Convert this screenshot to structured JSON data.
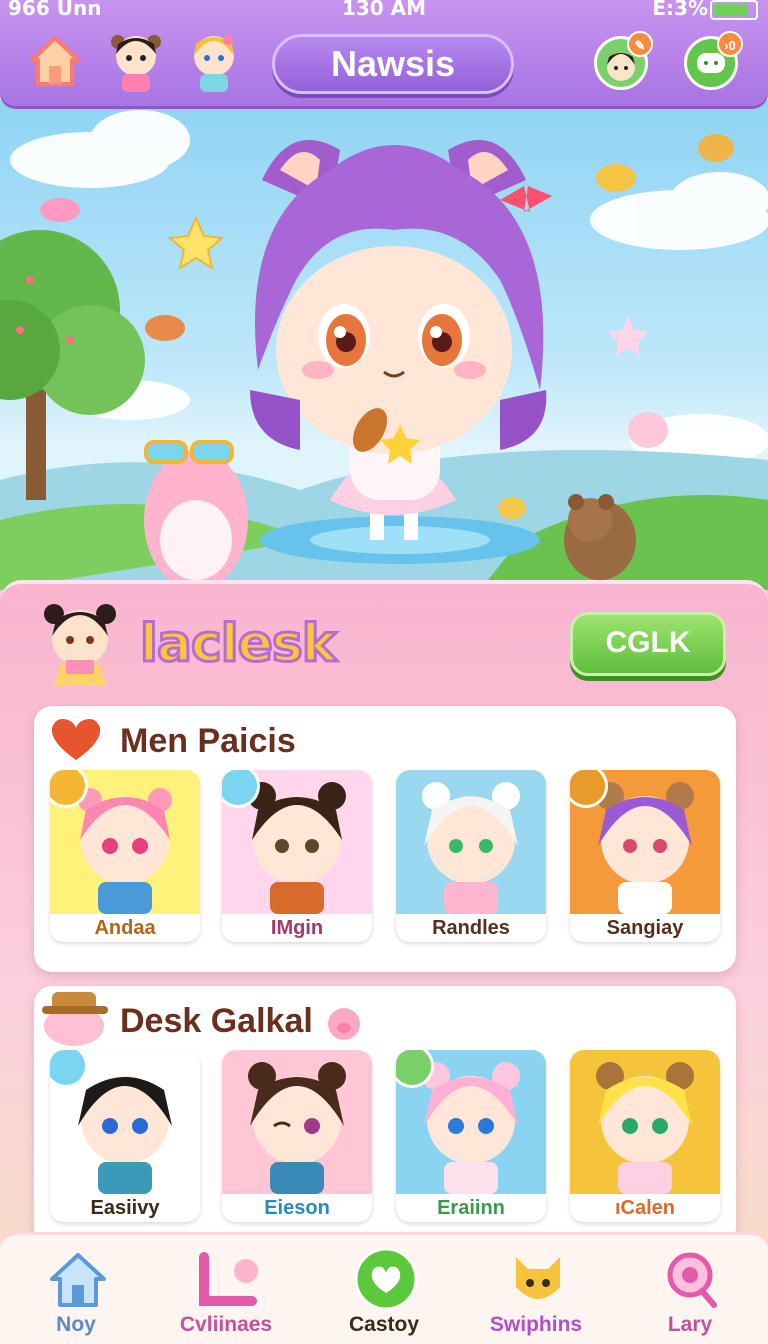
{
  "status": {
    "left": "966 Unn",
    "time": "130 AM",
    "right": "E:3%"
  },
  "header": {
    "title": "Nawsis",
    "badge": "›0"
  },
  "panel": {
    "title": "laclesk",
    "cta": "CGLK"
  },
  "sections": [
    {
      "title": "Men Paicis",
      "items": [
        "Andaa",
        "IMgin",
        "Randles",
        "Sangiay"
      ]
    },
    {
      "title": "Desk Galkal",
      "items": [
        "Easiivy",
        "Eieson",
        "Eraiinn",
        "ıCalen"
      ]
    }
  ],
  "nav": [
    "Noy",
    "Cvliinaes",
    "Castoy",
    "Swiphins",
    "Lary"
  ],
  "colors": {
    "accent": "#a874e2",
    "cta": "#5fbf3c",
    "panel": "#f9b4cf"
  },
  "icons": [
    "home-icon",
    "chat-icon",
    "heart-icon",
    "search-icon"
  ]
}
